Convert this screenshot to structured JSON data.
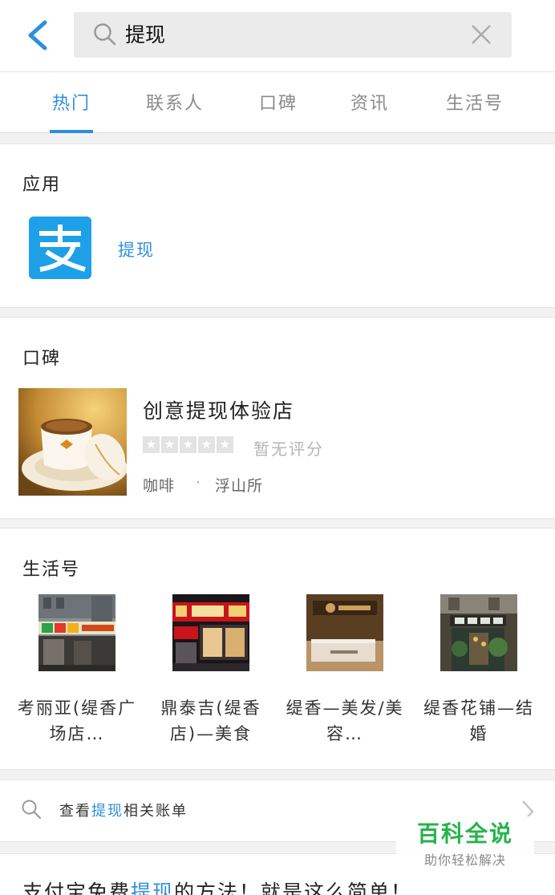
{
  "search": {
    "query": "提现",
    "icon": "search-icon",
    "clear_icon": "close-icon",
    "back_icon": "back-icon"
  },
  "tabs": [
    {
      "label": "热门",
      "active": true
    },
    {
      "label": "联系人",
      "active": false
    },
    {
      "label": "口碑",
      "active": false
    },
    {
      "label": "资讯",
      "active": false
    },
    {
      "label": "生活号",
      "active": false
    }
  ],
  "apps": {
    "title": "应用",
    "items": [
      {
        "name": "提现",
        "icon": "alipay-icon",
        "icon_glyph": "支"
      }
    ]
  },
  "koubei": {
    "title": "口碑",
    "shop": {
      "name": "创意提现体验店",
      "rating_text": "暂无评分",
      "rating": 0,
      "category": "咖啡",
      "separator": "·",
      "area": "浮山所"
    }
  },
  "life": {
    "title": "生活号",
    "items": [
      {
        "name": "考丽亚(缇香广场店…"
      },
      {
        "name": "鼎泰吉(缇香店)—美食"
      },
      {
        "name": "缇香—美发/美容…"
      },
      {
        "name": "缇香花铺—结婚"
      }
    ]
  },
  "bill": {
    "prefix": "查看",
    "keyword": "提现",
    "suffix": "相关账单"
  },
  "article": {
    "prefix": "支付宝免费",
    "keyword": "提现",
    "suffix": "的方法！就是这么简单！"
  },
  "watermark": {
    "main": "百科全说",
    "sub": "助你轻松解决"
  },
  "colors": {
    "accent": "#2e8fe0",
    "alipay_blue": "#1ea0e8",
    "watermark_green": "#27b34b"
  }
}
